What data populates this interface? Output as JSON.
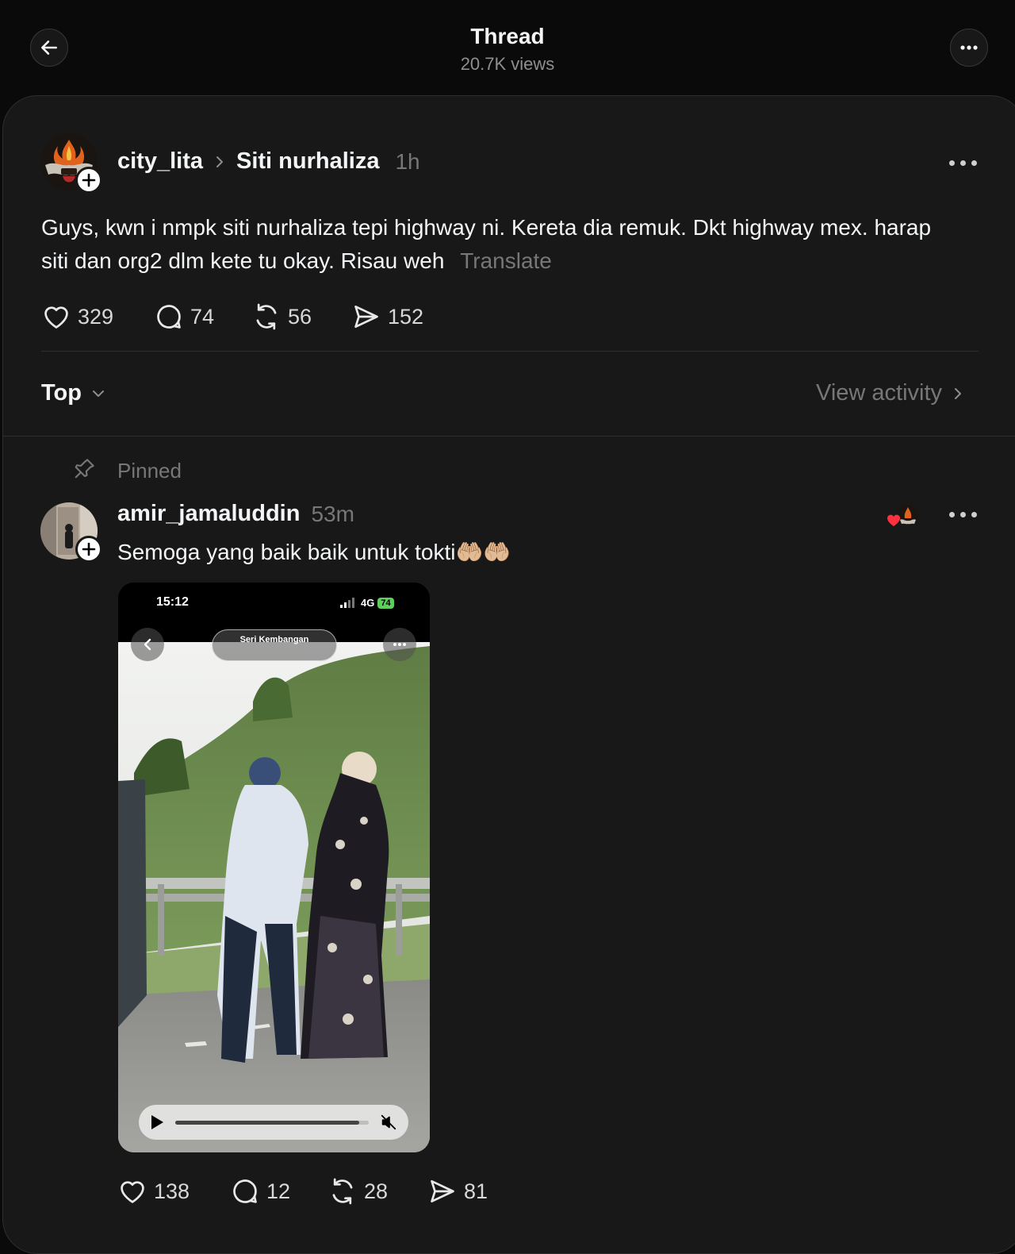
{
  "header": {
    "title": "Thread",
    "views": "20.7K views",
    "back_icon": "arrow-left-icon",
    "more_icon": "more-horizontal-icon"
  },
  "post": {
    "username": "city_lita",
    "topic": "Siti nurhaliza",
    "time": "1h",
    "text": "Guys, kwn i nmpk siti nurhaliza tepi highway ni. Kereta dia remuk. Dkt highway mex. harap siti dan org2 dlm kete tu okay. Risau weh",
    "translate": "Translate",
    "likes": "329",
    "comments": "74",
    "reposts": "56",
    "shares": "152"
  },
  "sort": {
    "label": "Top",
    "view_activity": "View activity"
  },
  "reply": {
    "pinned_label": "Pinned",
    "username": "amir_jamaluddin",
    "time": "53m",
    "text": "Semoga yang baik baik untuk tokti🤲🏼🤲🏼",
    "likes": "138",
    "comments": "12",
    "reposts": "28",
    "shares": "81",
    "video": {
      "status_time": "15:12",
      "network": "4G",
      "battery": "74",
      "location": "Seri Kembangan",
      "progress": 0.95
    }
  },
  "colors": {
    "background": "#0a0a0a",
    "panel": "#181818",
    "like_heart": "#ff3040"
  }
}
